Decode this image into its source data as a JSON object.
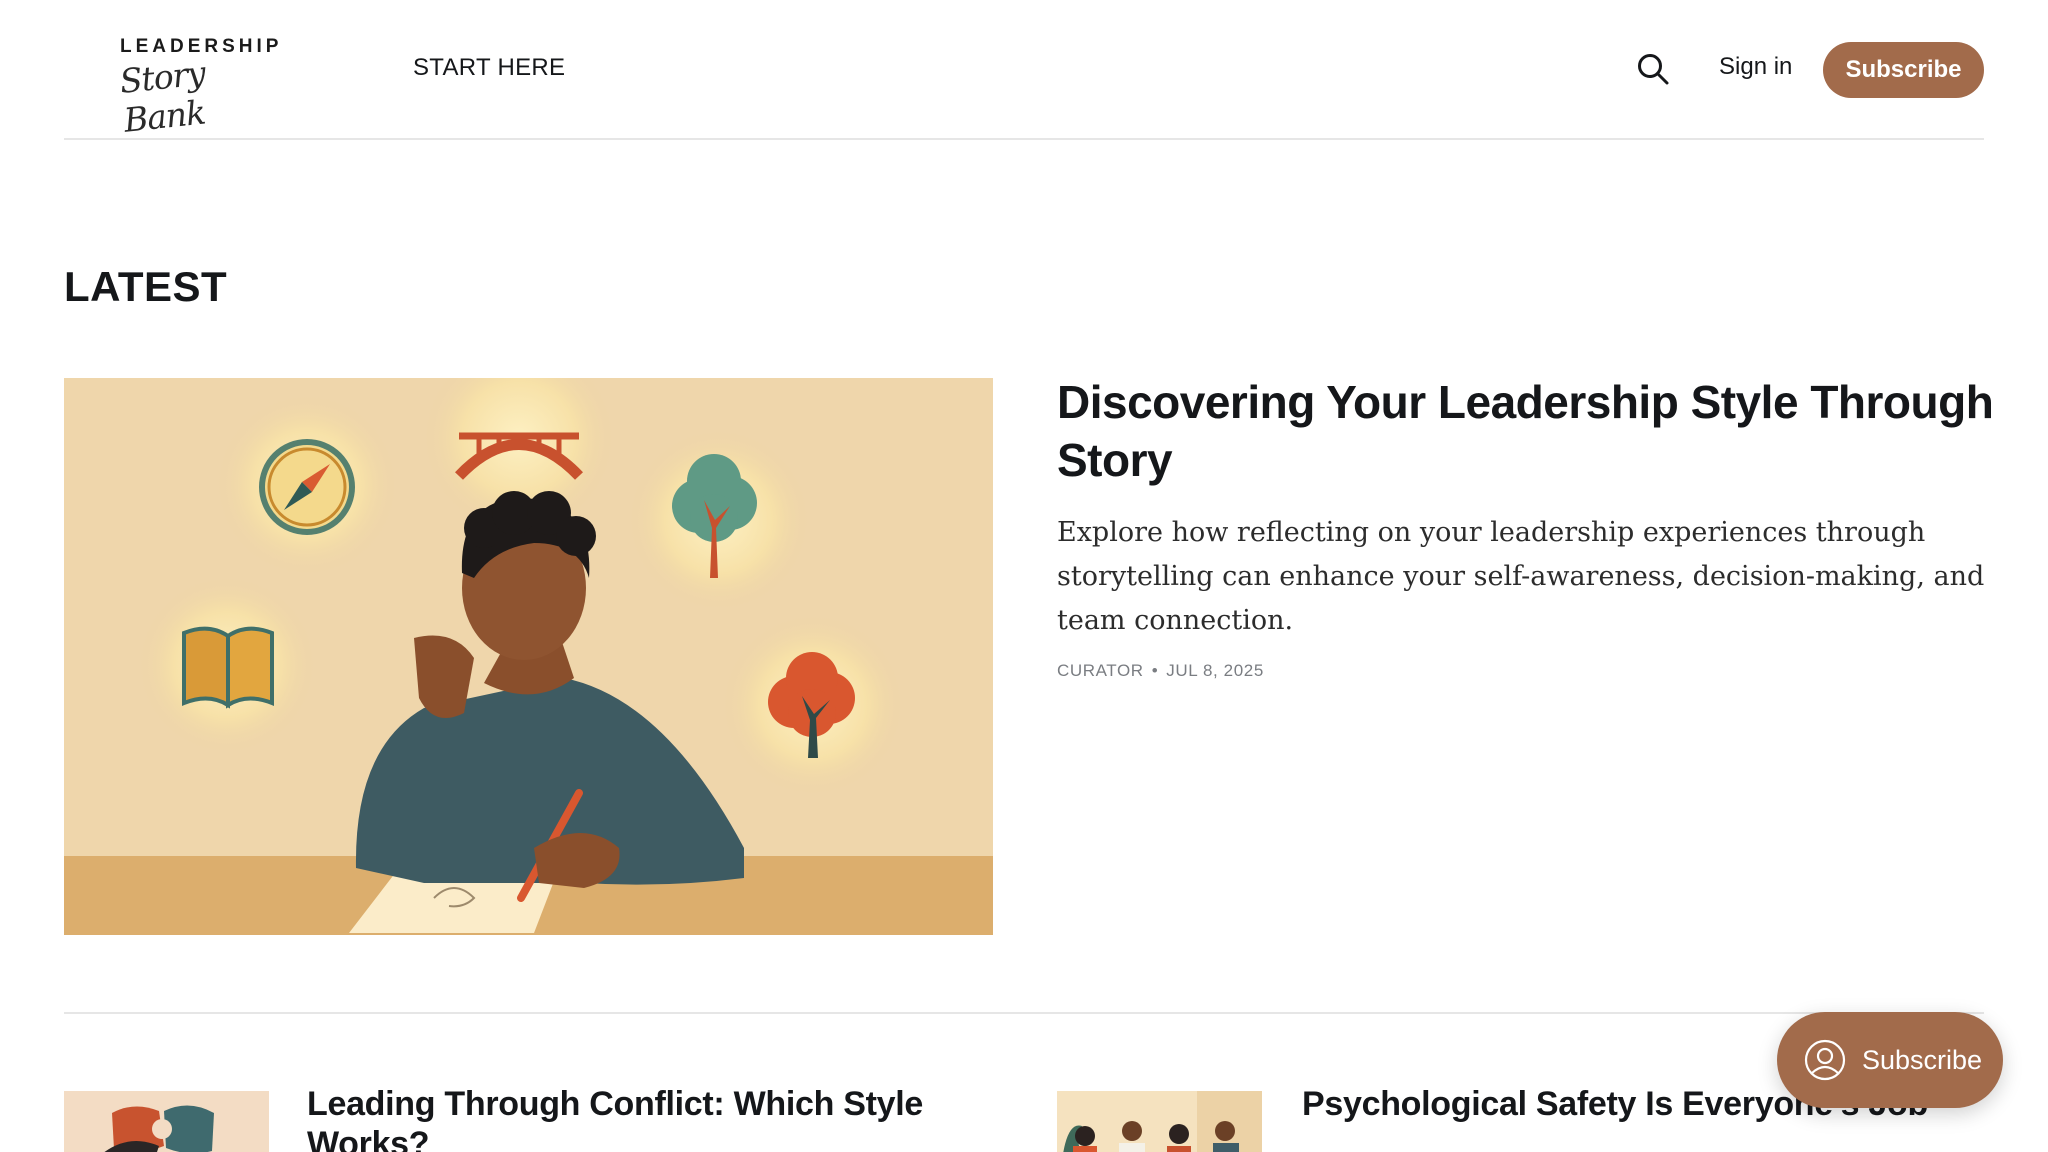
{
  "header": {
    "logo_top": "LEADERSHIP",
    "logo_script": "Story Bank",
    "nav_start": "START HERE",
    "signin": "Sign in",
    "subscribe": "Subscribe",
    "search_icon": "search-icon"
  },
  "section": {
    "title": "LATEST"
  },
  "hero": {
    "title": "Discovering Your Leadership Style Through Story",
    "excerpt": "Explore how reflecting on your leadership experiences through storytelling can enhance your self-awareness, decision-making, and team connection.",
    "author": "CURATOR",
    "date": "JUL 8, 2025"
  },
  "cards": [
    {
      "title": "Leading Through Conflict: Which Style Works?"
    },
    {
      "title": "Psychological Safety Is Everyone's Job"
    }
  ],
  "floating": {
    "subscribe": "Subscribe"
  },
  "colors": {
    "accent": "#a26b4b",
    "text": "#15171a",
    "meta": "#7a7d82"
  }
}
